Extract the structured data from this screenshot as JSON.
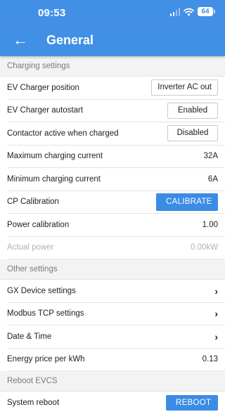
{
  "status_bar": {
    "time": "09:53",
    "battery": "64",
    "icons": [
      "signal-icon",
      "wifi-icon",
      "battery-icon"
    ]
  },
  "app_bar": {
    "title": "General",
    "back_icon": "arrow-left-icon"
  },
  "colors": {
    "accent": "#4290e6",
    "button": "#3b8ce4",
    "section_bg": "#f3f3f3"
  },
  "charging_settings": {
    "header": "Charging settings",
    "ev_charger_position": {
      "label": "EV Charger position",
      "value": "Inverter AC out"
    },
    "ev_charger_autostart": {
      "label": "EV Charger autostart",
      "value": "Enabled"
    },
    "contactor_active": {
      "label": "Contactor active when charged",
      "value": "Disabled"
    },
    "max_current": {
      "label": "Maximum charging current",
      "value": "32A"
    },
    "min_current": {
      "label": "Minimum charging current",
      "value": "6A"
    },
    "cp_calibration": {
      "label": "CP Calibration",
      "button": "CALIBRATE"
    },
    "power_calibration": {
      "label": "Power calibration",
      "value": "1.00"
    },
    "actual_power": {
      "label": "Actual power",
      "value": "0.00kW"
    }
  },
  "other_settings": {
    "header": "Other settings",
    "gx_device": {
      "label": "GX Device settings"
    },
    "modbus_tcp": {
      "label": "Modbus TCP settings"
    },
    "date_time": {
      "label": "Date & Time"
    },
    "energy_price": {
      "label": "Energy price per kWh",
      "value": "0.13"
    }
  },
  "reboot_section": {
    "header": "Reboot EVCS",
    "system_reboot": {
      "label": "System reboot",
      "button": "REBOOT"
    }
  }
}
